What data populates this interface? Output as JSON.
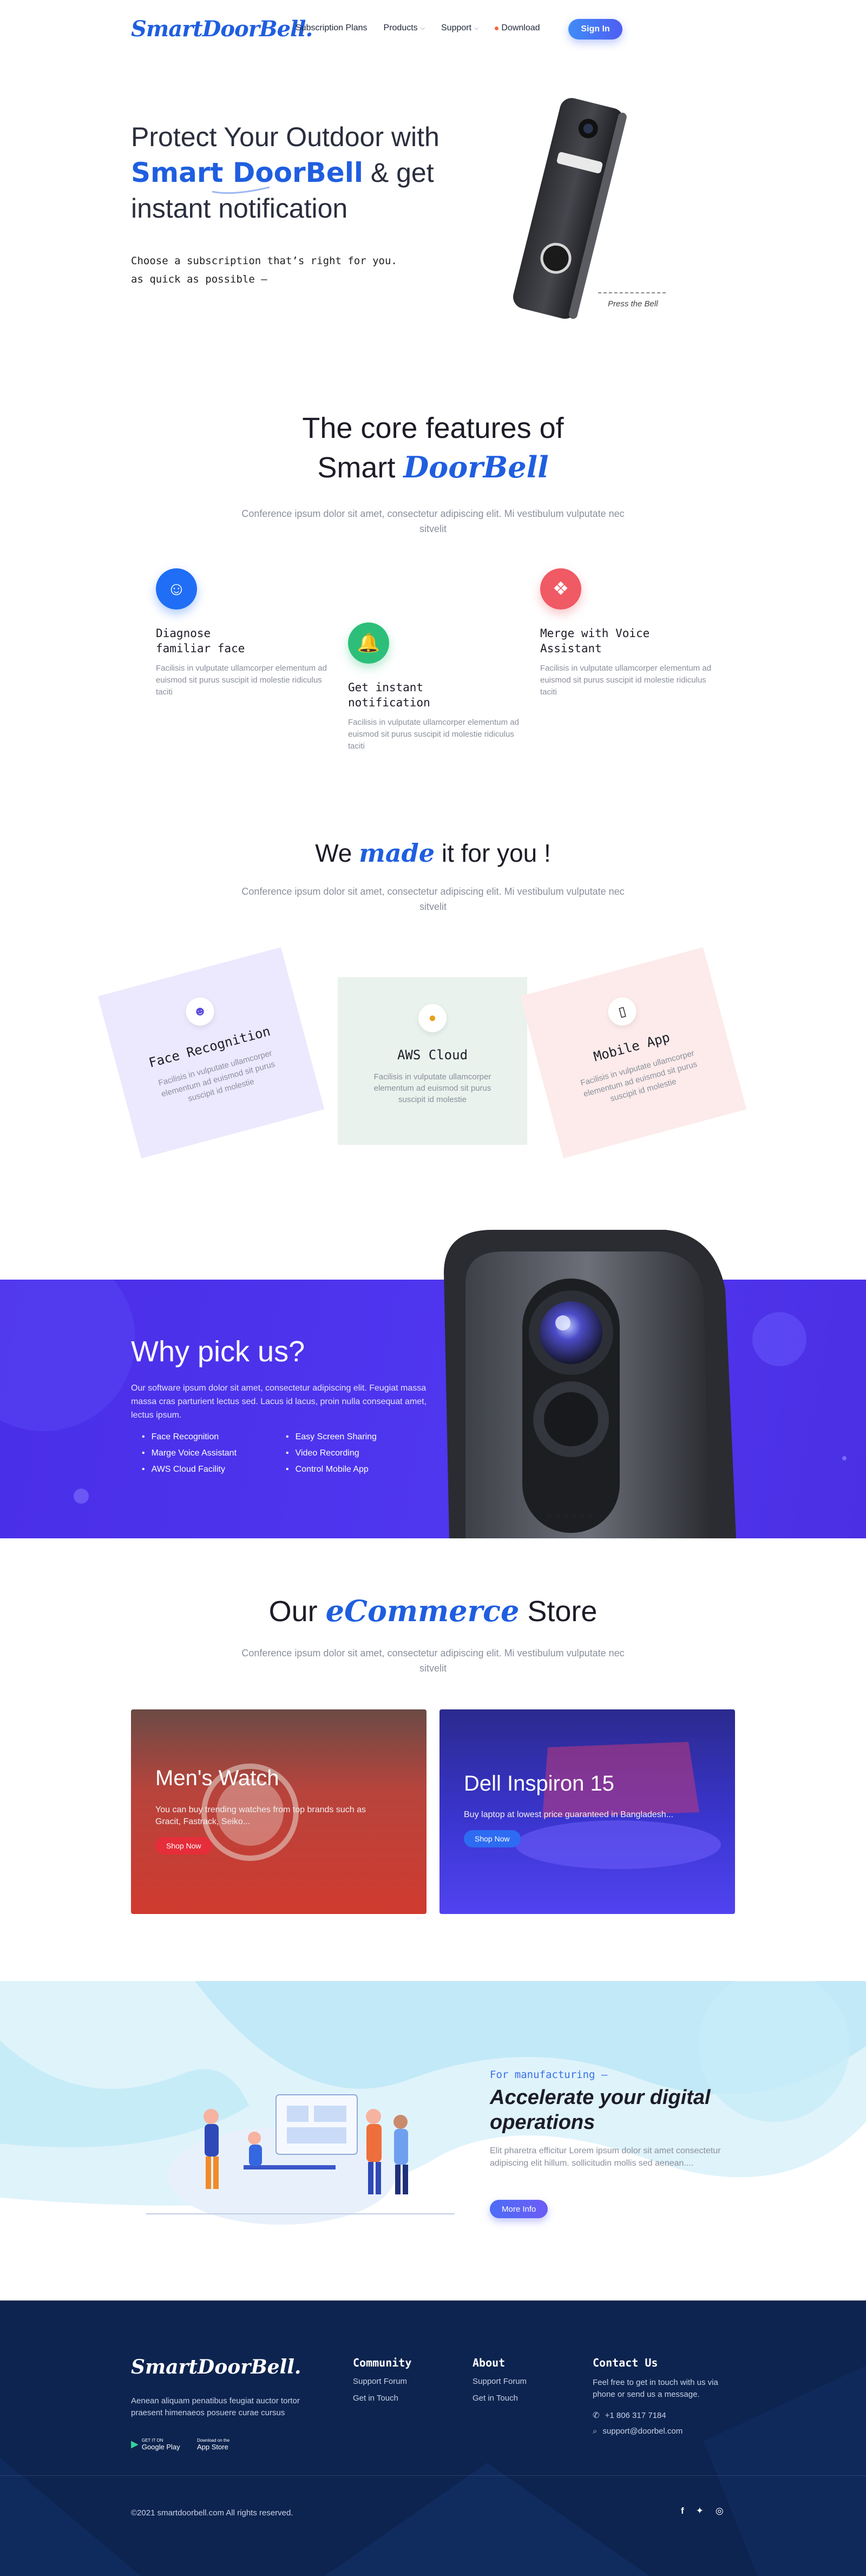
{
  "nav": {
    "logo": "SmartDoorBell.",
    "links": [
      "Subscription Plans",
      "Products",
      "Support",
      "Download"
    ],
    "signin": "Sign In"
  },
  "hero": {
    "line1": "Protect Your Outdoor with",
    "brand": "Smart DoorBell",
    "line2_rest": " & get",
    "line3": "instant notification",
    "sub1": "Choose a subscription that’s right for you.",
    "sub2": "as quick as possible —",
    "press": "Press the Bell"
  },
  "core": {
    "title_line1": "The core features of",
    "title_smart": "Smart ",
    "title_script": "DoorBell",
    "desc": "Conference ipsum dolor sit amet, consectetur adipiscing elit. Mi vestibulum vulputate nec sitvelit",
    "features": [
      {
        "title_a": "Diagnose",
        "title_b": "familiar face",
        "text": "Facilisis in vulputate ullamcorper elementum ad euismod sit purus suscipit id molestie ridiculus taciti",
        "color": "#1f6ef5"
      },
      {
        "title_a": "Get instant",
        "title_b": "notification",
        "text": "Facilisis in vulputate ullamcorper elementum ad euismod sit purus suscipit id molestie ridiculus taciti",
        "color": "#2dbf7a"
      },
      {
        "title_a": "Merge with Voice",
        "title_b": "Assistant",
        "text": "Facilisis in vulputate ullamcorper elementum ad euismod sit purus suscipit id molestie ridiculus taciti",
        "color": "#ef5a64"
      }
    ]
  },
  "made": {
    "title_a": "We ",
    "title_script": "made",
    "title_b": " it for you !",
    "desc": "Conference ipsum dolor sit amet, consectetur adipiscing elit. Mi vestibulum vulputate nec sitvelit",
    "cards": [
      {
        "title": "Face Recognition",
        "text": "Facilisis in vulputate ullamcorper elementum ad euismod sit purus suscipit id molestie",
        "bg": "#ece8fd"
      },
      {
        "title": "AWS Cloud",
        "text": "Facilisis in vulputate ullamcorper elementum ad euismod sit purus suscipit id molestie",
        "bg": "#e9f2ec"
      },
      {
        "title": "Mobile App",
        "text": "Facilisis in vulputate ullamcorper elementum ad euismod sit purus suscipit id molestie",
        "bg": "#fcebea"
      }
    ]
  },
  "why": {
    "title": "Why pick us?",
    "text": "Our software ipsum dolor sit amet, consectetur adipiscing elit. Feugiat massa massa cras parturient lectus sed. Lacus id lacus, proin nulla consequat amet, lectus ipsum.",
    "list_left": [
      "Face Recognition",
      "Marge Voice Assistant",
      "AWS Cloud Facility"
    ],
    "list_right": [
      "Easy Screen Sharing",
      "Video Recording",
      "Control Mobile App"
    ]
  },
  "store": {
    "title_a": "Our ",
    "title_script": "eCommerce",
    "title_b": " Store",
    "desc": "Conference ipsum dolor sit amet, consectetur adipiscing elit. Mi vestibulum vulputate nec sitvelit",
    "cards": [
      {
        "title": "Men's Watch",
        "text": "You can buy trending watches from top brands such as Gracit, Fastrack, Seiko...",
        "btn": "Shop Now"
      },
      {
        "title": "Dell Inspiron 15",
        "text": "Buy laptop at lowest price guaranteed in Bangladesh...",
        "btn": "Shop Now"
      }
    ]
  },
  "mfg": {
    "tag": "For manufacturing —",
    "title": "Accelerate your digital operations",
    "text": "Elit pharetra efficitur Lorem ipsum dolor sit amet consectetur adipiscing elit hillum. sollicitudin mollis sed aenean....",
    "btn": "More Info"
  },
  "footer": {
    "logo": "SmartDoorBell.",
    "about": "Aenean aliquam penatibus feugiat auctor tortor praesent himenaeos posuere curae cursus",
    "gplay_small": "GET IT ON",
    "gplay": "Google Play",
    "appstore_small": "Download on the",
    "appstore": "App Store",
    "community_title": "Community",
    "community_links": [
      "Support Forum",
      "Get in Touch"
    ],
    "about_title": "About",
    "about_links": [
      "Support Forum",
      "Get in Touch"
    ],
    "contact_title": "Contact Us",
    "contact_text": "Feel free to get in touch with us via phone or send us a message.",
    "phone": "+1 806 317 7184",
    "email": "support@doorbel.com",
    "copyright": "©2021 smartdoorbell.com All rights reserved."
  }
}
